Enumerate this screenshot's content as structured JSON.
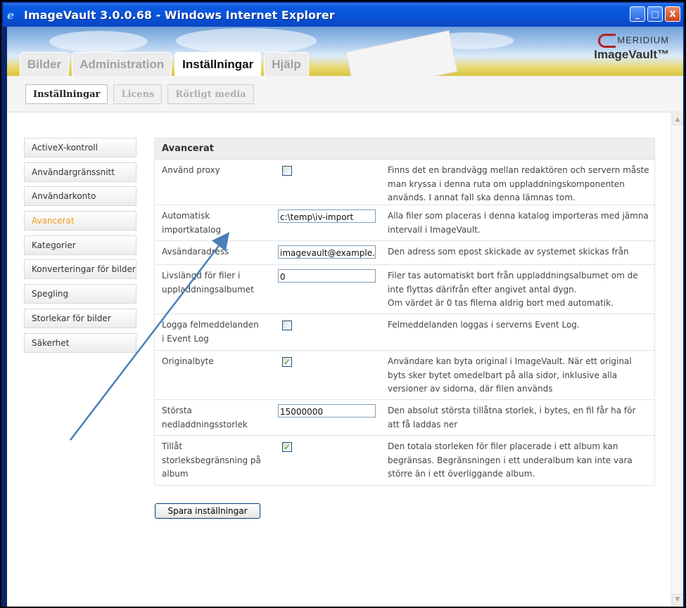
{
  "window": {
    "title": "ImageVault 3.0.0.68 - Windows Internet Explorer",
    "controls": [
      "_",
      "□",
      "X"
    ]
  },
  "header": {
    "brand_top": "MERIDIUM",
    "brand_bottom": "ImageVault™",
    "tabs": [
      {
        "label": "Bilder",
        "active": false
      },
      {
        "label": "Administration",
        "active": false
      },
      {
        "label": "Inställningar",
        "active": true
      },
      {
        "label": "Hjälp",
        "active": false
      }
    ]
  },
  "subtabs": [
    {
      "label": "Inställningar",
      "active": true
    },
    {
      "label": "Licens",
      "active": false
    },
    {
      "label": "Rörligt media",
      "active": false
    }
  ],
  "sidenav": [
    {
      "label": "ActiveX-kontroll",
      "active": false
    },
    {
      "label": "Användargränssnitt",
      "active": false
    },
    {
      "label": "Användarkonto",
      "active": false
    },
    {
      "label": "Avancerat",
      "active": true
    },
    {
      "label": "Kategorier",
      "active": false
    },
    {
      "label": "Konverteringar för bilder",
      "active": false
    },
    {
      "label": "Spegling",
      "active": false
    },
    {
      "label": "Storlekar för bilder",
      "active": false
    },
    {
      "label": "Säkerhet",
      "active": false
    }
  ],
  "panel": {
    "title": "Avancerat",
    "rows": [
      {
        "label": "Använd proxy",
        "type": "checkbox",
        "checked": false,
        "desc": "Finns det en brandvägg mellan redaktören och servern måste man kryssa i denna ruta om uppladdningskomponenten används. I annat fall ska denna lämnas tom."
      },
      {
        "label": "Automatisk importkatalog",
        "type": "text",
        "value": "c:\\temp\\iv-import",
        "desc": "Alla filer som placeras i denna katalog importeras med jämna intervall i ImageVault."
      },
      {
        "label": "Avsändaradress",
        "type": "text",
        "value": "imagevault@example.com",
        "desc": "Den adress som epost skickade av systemet skickas från"
      },
      {
        "label": "Livslängd för filer i uppladdningsalbumet",
        "type": "text",
        "value": "0",
        "desc": "Filer tas automatiskt bort från uppladdningsalbumet om de inte flyttas därifrån efter angivet antal dygn.\nOm värdet är 0 tas filerna aldrig bort med automatik."
      },
      {
        "label": "Logga felmeddelanden i Event Log",
        "type": "checkbox",
        "checked": false,
        "desc": "Felmeddelanden loggas i serverns Event Log."
      },
      {
        "label": "Originalbyte",
        "type": "checkbox",
        "checked": true,
        "desc": "Användare kan byta original i ImageVault. När ett original byts sker bytet omedelbart på alla sidor, inklusive alla versioner av sidorna, där filen används"
      },
      {
        "label": "Största nedladdningsstorlek",
        "type": "text",
        "value": "15000000",
        "desc": "Den absolut största tillåtna storlek, i bytes, en fil får ha för att få laddas ner"
      },
      {
        "label": "Tillåt storleksbegränsning på album",
        "type": "checkbox",
        "checked": true,
        "desc": "Den totala storleken för filer placerade i ett album kan begränsas. Begränsningen i ett underalbum kan inte vara större än i ett överliggande album."
      }
    ]
  },
  "save_label": "Spara inställningar",
  "arrow_color": "#4a7fb8",
  "accent_color": "#f39a1c"
}
